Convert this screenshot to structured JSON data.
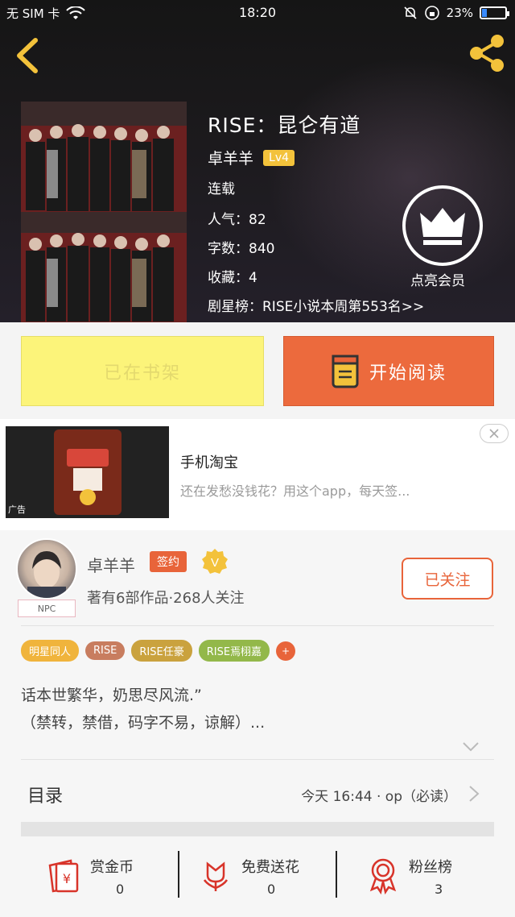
{
  "status_bar": {
    "carrier_1": "无 SIM 卡",
    "time": "18:20",
    "battery": "23%",
    "battery_level": 0.23
  },
  "header": {
    "book_title": "RISE：昆仑有道",
    "author": "卓羊羊",
    "level": "Lv4",
    "status": "连载",
    "popularity": "人气：82",
    "word_count": "字数：840",
    "favorites": "收藏：4",
    "ranking": "剧星榜：RISE小说本周第553名>>",
    "vip_label": "点亮会员"
  },
  "buttons": {
    "shelf": "已在书架",
    "read": "开始阅读"
  },
  "ad": {
    "title": "手机淘宝",
    "description": "还在发愁没钱花？用这个app，每天签...",
    "tag": "广告"
  },
  "author_card": {
    "name": "卓羊羊",
    "sign_badge": "签约",
    "v_badge": "V",
    "meta": "著有6部作品·268人关注",
    "follow_button": "已关注",
    "npc_tag": "NPC",
    "tags": [
      {
        "label": "明星同人",
        "color": "#f0b43c"
      },
      {
        "label": "RISE",
        "color": "#c87d5f"
      },
      {
        "label": "RISE任豪",
        "color": "#caa23e"
      },
      {
        "label": "RISE焉栩嘉",
        "color": "#93b84a"
      }
    ],
    "tag_plus": "+",
    "intro_line_1": "话本世繁华，奶思尽风流.”",
    "intro_line_2": "（禁转，禁借，码字不易，谅解）..."
  },
  "toc": {
    "label": "目录",
    "latest": "今天 16:44 · op（必读）"
  },
  "actions": [
    {
      "label": "赏金币",
      "count": "0",
      "icon": "red-envelope-icon"
    },
    {
      "label": "免费送花",
      "count": "0",
      "icon": "flower-icon"
    },
    {
      "label": "粉丝榜",
      "count": "3",
      "icon": "medal-icon"
    }
  ],
  "colors": {
    "accent": "#e8643a",
    "shelf_yellow": "#fcf47a",
    "lv_badge": "#f3c23b"
  }
}
